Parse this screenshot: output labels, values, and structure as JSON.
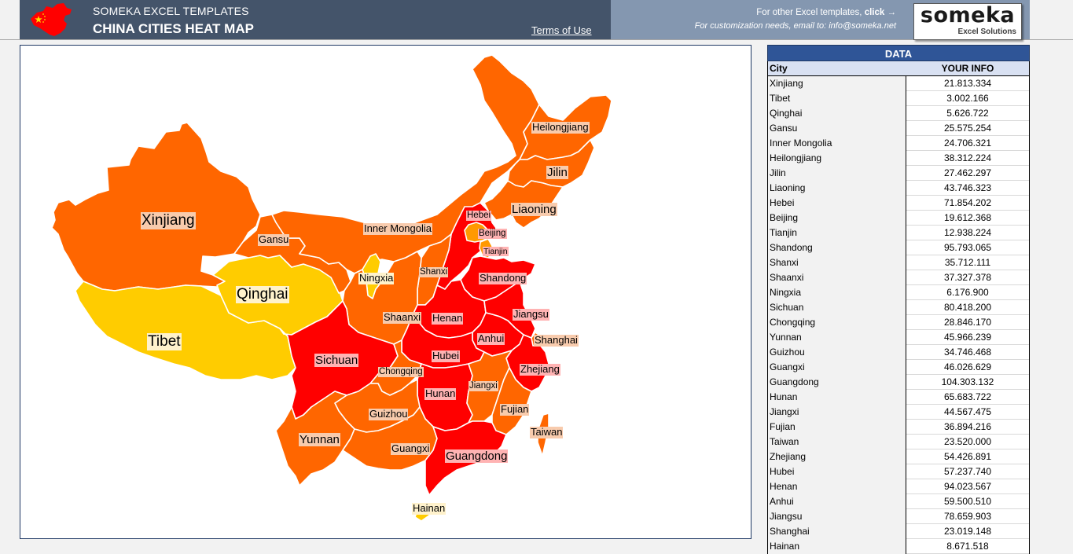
{
  "header": {
    "brand": "SOMEKA EXCEL TEMPLATES",
    "title": "CHINA CITIES HEAT MAP",
    "terms_link": "Terms of Use",
    "promo_text": "For other Excel templates,",
    "promo_click": "click →",
    "promo_email": "For customization needs, email to: info@someka.net",
    "logo_main": "someka",
    "logo_sub": "Excel Solutions"
  },
  "colors": {
    "header_dark": "#44546a",
    "header_light": "#8497b0",
    "scale_low": "#ffcc00",
    "scale_mid_low": "#ff9900",
    "scale_mid": "#ff6600",
    "scale_high": "#ff0000",
    "table_header": "#2f5597",
    "table_subheader": "#d9e1f2"
  },
  "data_table": {
    "title": "DATA",
    "col_city": "City",
    "col_value": "YOUR INFO",
    "rows": [
      {
        "city": "Xinjiang",
        "value": "21.813.334"
      },
      {
        "city": "Tibet",
        "value": "3.002.166"
      },
      {
        "city": "Qinghai",
        "value": "5.626.722"
      },
      {
        "city": "Gansu",
        "value": "25.575.254"
      },
      {
        "city": "Inner Mongolia",
        "value": "24.706.321"
      },
      {
        "city": "Heilongjiang",
        "value": "38.312.224"
      },
      {
        "city": "Jilin",
        "value": "27.462.297"
      },
      {
        "city": "Liaoning",
        "value": "43.746.323"
      },
      {
        "city": "Hebei",
        "value": "71.854.202"
      },
      {
        "city": "Beijing",
        "value": "19.612.368"
      },
      {
        "city": "Tianjin",
        "value": "12.938.224"
      },
      {
        "city": "Shandong",
        "value": "95.793.065"
      },
      {
        "city": "Shanxi",
        "value": "35.712.111"
      },
      {
        "city": "Shaanxi",
        "value": "37.327.378"
      },
      {
        "city": "Ningxia",
        "value": "6.176.900"
      },
      {
        "city": "Sichuan",
        "value": "80.418.200"
      },
      {
        "city": "Chongqing",
        "value": "28.846.170"
      },
      {
        "city": "Yunnan",
        "value": "45.966.239"
      },
      {
        "city": "Guizhou",
        "value": "34.746.468"
      },
      {
        "city": "Guangxi",
        "value": "46.026.629"
      },
      {
        "city": "Guangdong",
        "value": "104.303.132"
      },
      {
        "city": "Hunan",
        "value": "65.683.722"
      },
      {
        "city": "Jiangxi",
        "value": "44.567.475"
      },
      {
        "city": "Fujian",
        "value": "36.894.216"
      },
      {
        "city": "Taiwan",
        "value": "23.520.000"
      },
      {
        "city": "Zhejiang",
        "value": "54.426.891"
      },
      {
        "city": "Hubei",
        "value": "57.237.740"
      },
      {
        "city": "Henan",
        "value": "94.023.567"
      },
      {
        "city": "Anhui",
        "value": "59.500.510"
      },
      {
        "city": "Jiangsu",
        "value": "78.659.903"
      },
      {
        "city": "Shanghai",
        "value": "23.019.148"
      },
      {
        "city": "Hainan",
        "value": "8.671.518"
      }
    ]
  },
  "map": {
    "labels": {
      "xinjiang": "Xinjiang",
      "tibet": "Tibet",
      "qinghai": "Qinghai",
      "gansu": "Gansu",
      "inner_mongolia": "Inner Mongolia",
      "heilongjiang": "Heilongjiang",
      "jilin": "Jilin",
      "liaoning": "Liaoning",
      "hebei": "Hebei",
      "beijing": "Beijing",
      "tianjin": "Tianjin",
      "shandong": "Shandong",
      "shanxi": "Shanxi",
      "shaanxi": "Shaanxi",
      "ningxia": "Ningxia",
      "sichuan": "Sichuan",
      "chongqing": "Chongqing",
      "yunnan": "Yunnan",
      "guizhou": "Guizhou",
      "guangxi": "Guangxi",
      "guangdong": "Guangdong",
      "hunan": "Hunan",
      "jiangxi": "Jiangxi",
      "fujian": "Fujian",
      "taiwan": "Taiwan",
      "zhejiang": "Zhejiang",
      "hubei": "Hubei",
      "henan": "Henan",
      "anhui": "Anhui",
      "jiangsu": "Jiangsu",
      "shanghai": "Shanghai",
      "hainan": "Hainan"
    },
    "fills": {
      "xinjiang": "#ff6600",
      "tibet": "#ffcc00",
      "qinghai": "#ffcc00",
      "gansu": "#ff6600",
      "inner_mongolia": "#ff6600",
      "heilongjiang": "#ff6600",
      "jilin": "#ff6600",
      "liaoning": "#ff6600",
      "hebei": "#ff0000",
      "beijing": "#ff9900",
      "tianjin": "#ff9900",
      "shandong": "#ff0000",
      "shanxi": "#ff6600",
      "shaanxi": "#ff6600",
      "ningxia": "#ffcc00",
      "sichuan": "#ff0000",
      "chongqing": "#ff6600",
      "yunnan": "#ff6600",
      "guizhou": "#ff6600",
      "guangxi": "#ff6600",
      "guangdong": "#ff0000",
      "hunan": "#ff0000",
      "jiangxi": "#ff6600",
      "fujian": "#ff6600",
      "taiwan": "#ff6600",
      "zhejiang": "#ff0000",
      "hubei": "#ff0000",
      "henan": "#ff0000",
      "anhui": "#ff0000",
      "jiangsu": "#ff0000",
      "shanghai": "#ff6600",
      "hainan": "#ffcc00"
    },
    "label_bg": {
      "yellow": "#fff2cc",
      "orange": "#f8cbad",
      "red": "#ffb3b3"
    }
  }
}
